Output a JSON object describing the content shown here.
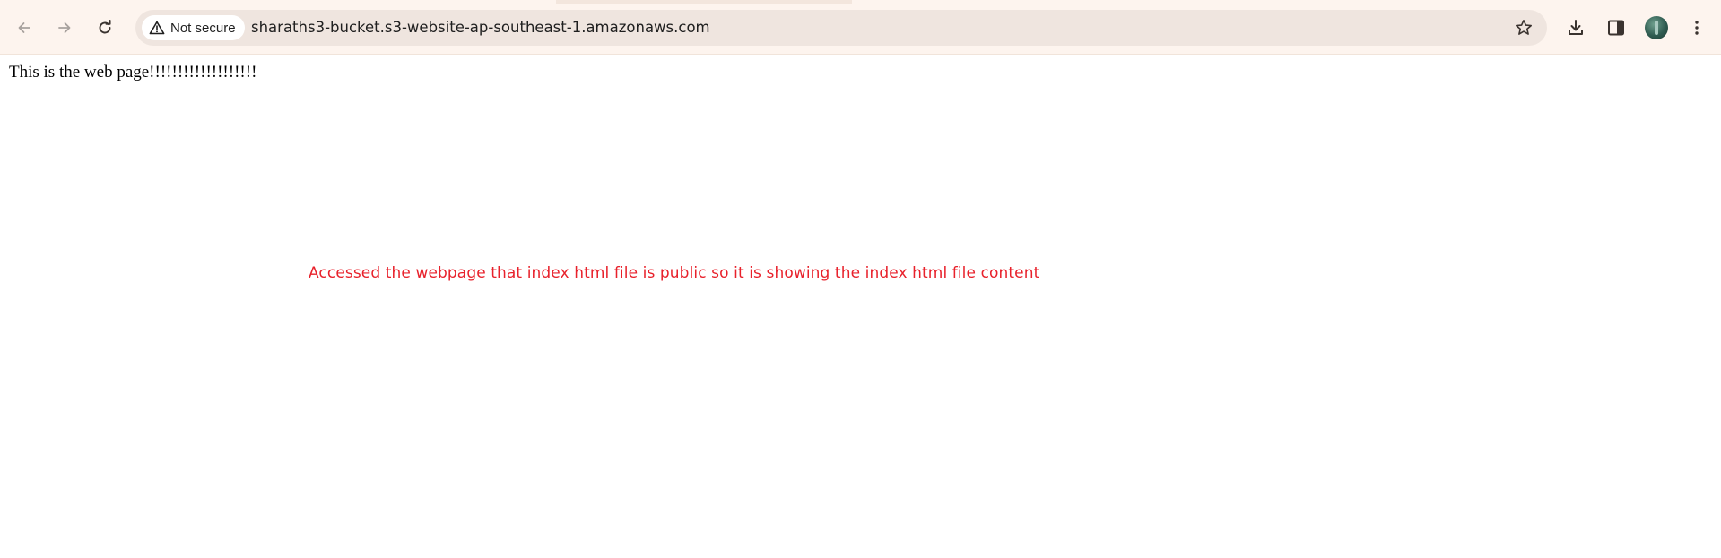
{
  "browser": {
    "security_label": "Not secure",
    "url": "sharaths3-bucket.s3-website-ap-southeast-1.amazonaws.com",
    "icons": {
      "back": "back-arrow-icon",
      "forward": "forward-arrow-icon",
      "reload": "reload-icon",
      "warning": "warning-triangle-icon",
      "bookmark": "star-icon",
      "download": "download-icon",
      "side_panel": "side-panel-icon",
      "profile": "avatar",
      "menu": "kebab-menu-icon"
    },
    "colors": {
      "toolbar_bg": "#fdf4ee",
      "omnibox_bg": "#efe5df"
    }
  },
  "page": {
    "body_text": "This is the web page!!!!!!!!!!!!!!!!!!!"
  },
  "annotation": {
    "text": "Accessed the webpage that index html file is public so it is showing the index html file content",
    "color": "#e8212b"
  }
}
